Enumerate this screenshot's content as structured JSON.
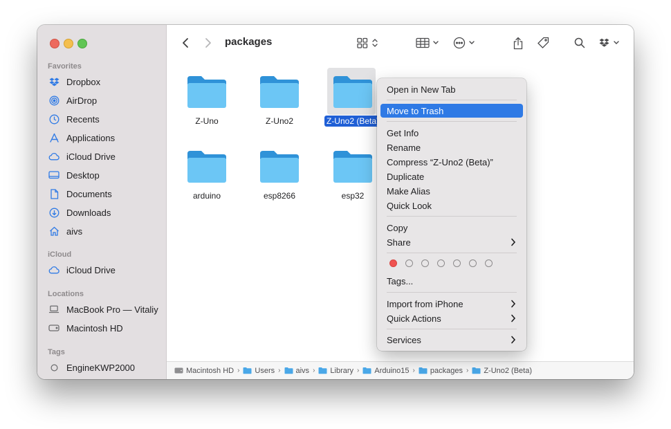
{
  "window": {
    "title": "packages"
  },
  "sidebar": {
    "favorites_header": "Favorites",
    "favorites": [
      {
        "label": "Dropbox",
        "icon": "dropbox-icon"
      },
      {
        "label": "AirDrop",
        "icon": "airdrop-icon"
      },
      {
        "label": "Recents",
        "icon": "clock-icon"
      },
      {
        "label": "Applications",
        "icon": "applications-icon"
      },
      {
        "label": "iCloud Drive",
        "icon": "cloud-icon"
      },
      {
        "label": "Desktop",
        "icon": "desktop-icon"
      },
      {
        "label": "Documents",
        "icon": "document-icon"
      },
      {
        "label": "Downloads",
        "icon": "download-icon"
      },
      {
        "label": "aivs",
        "icon": "home-icon"
      }
    ],
    "icloud_header": "iCloud",
    "icloud": [
      {
        "label": "iCloud Drive",
        "icon": "cloud-icon"
      }
    ],
    "locations_header": "Locations",
    "locations": [
      {
        "label": "MacBook Pro — Vitaliy",
        "icon": "laptop-icon"
      },
      {
        "label": "Macintosh HD",
        "icon": "harddisk-icon"
      }
    ],
    "tags_header": "Tags",
    "tags": [
      {
        "label": "EngineKWP2000",
        "icon": "tag-circle-icon"
      }
    ]
  },
  "folders": [
    {
      "name": "Z-Uno",
      "selected": false
    },
    {
      "name": "Z-Uno2",
      "selected": false
    },
    {
      "name": "Z-Uno2 (Beta)",
      "selected": true
    },
    {
      "name": "arduino",
      "selected": false
    },
    {
      "name": "esp8266",
      "selected": false
    },
    {
      "name": "esp32",
      "selected": false
    }
  ],
  "pathbar": [
    {
      "label": "Macintosh HD",
      "icon": "harddisk-icon"
    },
    {
      "label": "Users",
      "icon": "folder-icon"
    },
    {
      "label": "aivs",
      "icon": "folder-icon"
    },
    {
      "label": "Library",
      "icon": "folder-icon"
    },
    {
      "label": "Arduino15",
      "icon": "folder-icon"
    },
    {
      "label": "packages",
      "icon": "folder-icon"
    },
    {
      "label": "Z-Uno2 (Beta)",
      "icon": "folder-icon"
    }
  ],
  "context_menu": {
    "open_new_tab": "Open in New Tab",
    "move_to_trash": "Move to Trash",
    "get_info": "Get Info",
    "rename": "Rename",
    "compress": "Compress “Z-Uno2 (Beta)”",
    "duplicate": "Duplicate",
    "make_alias": "Make Alias",
    "quick_look": "Quick Look",
    "copy": "Copy",
    "share": "Share",
    "tags": "Tags...",
    "import_iphone": "Import from iPhone",
    "quick_actions": "Quick Actions",
    "services": "Services",
    "tag_colors": [
      "#ef5350",
      "none",
      "none",
      "none",
      "none",
      "none",
      "none"
    ]
  },
  "colors": {
    "accent": "#2f7ae5",
    "folder_top": "#2f92d8",
    "folder_body": "#6cc6f5",
    "sidebar_icon": "#2f7ae5"
  }
}
